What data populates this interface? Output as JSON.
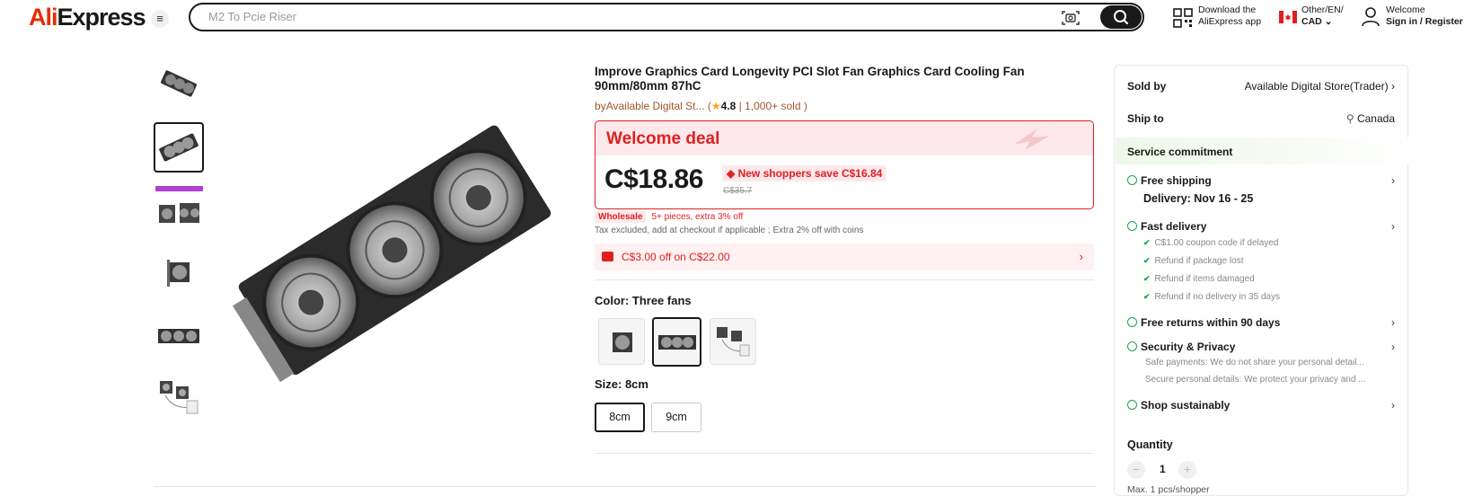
{
  "header": {
    "logo": {
      "part1": "Ali",
      "part2": "Express"
    },
    "menu_icon": "≡",
    "search_placeholder": "M2 To Pcie Riser",
    "download_line1": "Download the",
    "download_line2": "AliExpress app",
    "locale_line1": "Other/EN/",
    "locale_line2": "CAD",
    "welcome_line1": "Welcome",
    "welcome_line2": "Sign in / Register"
  },
  "product": {
    "title": "Improve Graphics Card Longevity PCI Slot Fan Graphics Card Cooling Fan 90mm/80mm 87hC",
    "by_prefix": "by",
    "store": "Available Digital St...",
    "rating": "4.8",
    "sold": "1,000+ sold )",
    "rating_open": " (",
    "sep": " | "
  },
  "deal": {
    "title": "Welcome deal",
    "price": "C$18.86",
    "save_text": "New shoppers save C$16.84",
    "old_price": "C$35.7"
  },
  "wholesale": {
    "tag": "Wholesale",
    "text": "5+ pieces, extra 3% off"
  },
  "tax_note": "Tax excluded, add at checkout if applicable ; Extra 2% off with coins",
  "coupon": {
    "text": "C$3.00 off on C$22.00"
  },
  "color": {
    "label": "Color: Three fans"
  },
  "size": {
    "label": "Size: 8cm",
    "options": [
      "8cm",
      "9cm"
    ]
  },
  "panel": {
    "sold_by_label": "Sold by",
    "sold_by_value": "Available Digital Store(Trader)",
    "ship_to_label": "Ship to",
    "ship_to_value": "Canada",
    "service_commitment": "Service commitment",
    "free_shipping": "Free shipping",
    "delivery": "Delivery: Nov 16 - 25",
    "fast_delivery": "Fast delivery",
    "fast_items": [
      "C$1.00 coupon code if delayed",
      "Refund if package lost",
      "Refund if items damaged",
      "Refund if no delivery in 35 days"
    ],
    "free_returns": "Free returns within 90 days",
    "security": "Security & Privacy",
    "security_items": [
      "Safe payments: We do not share your personal detail...",
      "Secure personal details: We protect your privacy and ..."
    ],
    "shop_sustainably": "Shop sustainably",
    "quantity_label": "Quantity",
    "quantity_value": "1",
    "max_note": "Max. 1 pcs/shopper"
  },
  "colors": {
    "accent_red": "#e02020",
    "brand_orange": "#e62e04",
    "green": "#1aa34a",
    "brown_link": "#a0572a"
  }
}
